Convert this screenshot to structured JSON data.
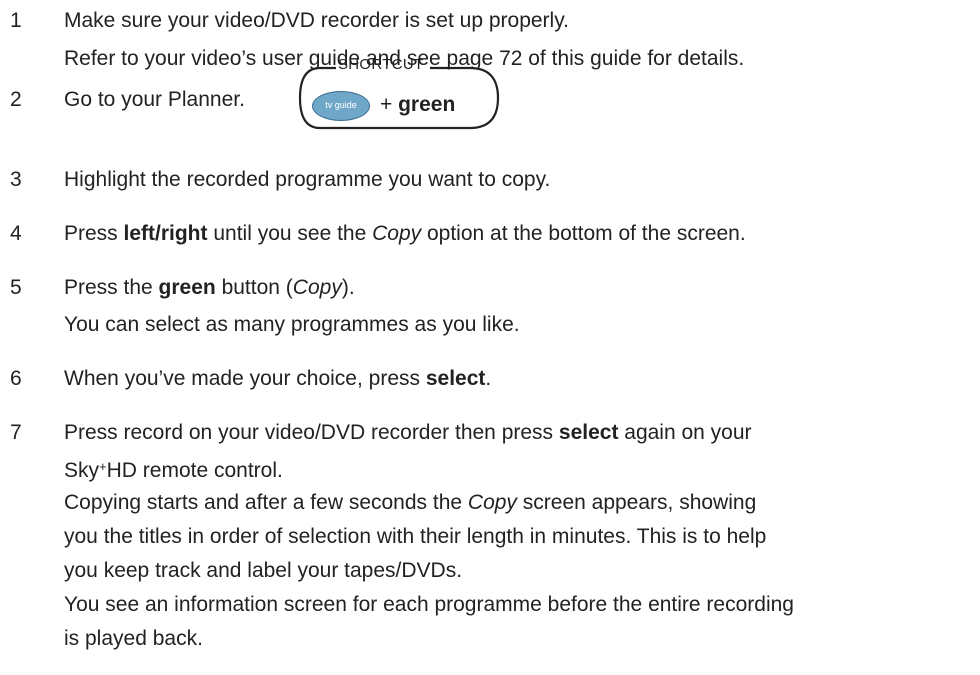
{
  "steps": [
    {
      "number": "1",
      "lines": [
        "Make sure your video/DVD recorder is set up properly.",
        "Refer to your video’s user guide and see page 72 of this guide for details."
      ]
    },
    {
      "number": "2",
      "text": "Go to your Planner."
    },
    {
      "number": "3",
      "text": "Highlight the recorded programme you want to copy."
    },
    {
      "number": "4",
      "parts": [
        "Press ",
        "left/right",
        " until you see the ",
        "Copy",
        " option at the bottom of the screen."
      ]
    },
    {
      "number": "5",
      "parts": [
        "Press the ",
        "green",
        " button (",
        "Copy",
        ")."
      ],
      "line2": "You can select as many programmes as you like."
    },
    {
      "number": "6",
      "parts": [
        "When you’ve made your choice, press ",
        "select",
        "."
      ]
    },
    {
      "number": "7",
      "parts": [
        "Press record on your video/DVD recorder then press ",
        "select",
        " again on your"
      ],
      "line2_parts": [
        "Sky",
        "+",
        "HD remote control."
      ],
      "line3_parts": [
        "Copying starts and after a few seconds the ",
        "Copy",
        " screen appears, showing"
      ],
      "line4": "you the titles in order of selection with their length in minutes. This is to help",
      "line5": "you keep track and label your tapes/DVDs.",
      "line6": "You see an information screen for each programme before the entire recording",
      "line7": "is played back."
    }
  ],
  "shortcut": {
    "label": "SHORTCUT",
    "button_label": "tv guide",
    "plus": "+ ",
    "key": "green",
    "button_color": "#6fa7c9"
  }
}
